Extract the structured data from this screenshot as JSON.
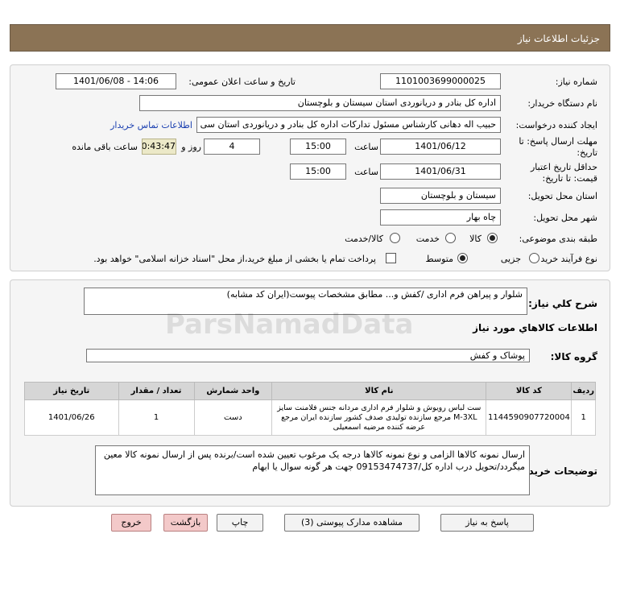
{
  "header": {
    "title": "جزئیات اطلاعات نیاز"
  },
  "form": {
    "need_number_label": "شماره نیاز:",
    "need_number": "1101003699000025",
    "announce_label": "تاریخ و ساعت اعلان عمومی:",
    "announce_value": "1401/06/08 - 14:06",
    "buyer_org_label": "نام دستگاه خریدار:",
    "buyer_org": "اداره کل بنادر و دریانوردی استان سیستان و بلوچستان",
    "creator_label": "ایجاد کننده درخواست:",
    "creator": "حبیب اله دهانی کارشناس مسئول تدارکات اداره کل بنادر و دریانوردی استان سی",
    "contact_link": "اطلاعات تماس خریدار",
    "reply_deadline_label": "مهلت ارسال پاسخ: تا",
    "reply_deadline_label2": "تاریخ:",
    "reply_date": "1401/06/12",
    "time_label": "ساعت",
    "reply_time": "15:00",
    "days_value": "4",
    "days_label": "روز و",
    "remaining_value": "00:43:47",
    "remaining_label": "ساعت باقی مانده",
    "validity_label": "حداقل تاریخ اعتبار",
    "validity_label2": "قیمت: تا تاریخ:",
    "validity_date": "1401/06/31",
    "validity_time_label": "ساعت",
    "validity_time": "15:00",
    "province_label": "استان محل تحویل:",
    "province": "سیستان و بلوچستان",
    "city_label": "شهر محل تحویل:",
    "city": "چاه بهار",
    "category_label": "طبقه بندی موضوعی:",
    "category_options": [
      "کالا",
      "خدمت",
      "کالا/خدمت"
    ],
    "process_label": "نوع فرآیند خرید :",
    "process_options": [
      "جزیی",
      "متوسط"
    ],
    "payment_note": "پرداخت تمام یا بخشی از مبلغ خرید،از محل \"اسناد خزانه اسلامی\" خواهد بود."
  },
  "summary": {
    "label": "شرح کلي نياز:",
    "value": "شلوار و پیراهن فرم اداری /کفش و... مطابق مشخصات پیوست(ایران کد مشابه)"
  },
  "goods_section_title": "اطلاعات کالاهاي مورد نياز",
  "goods_group": {
    "label": "گروه کالا:",
    "value": "پوشاک و کفش"
  },
  "table": {
    "headers": [
      "ردیف",
      "کد کالا",
      "نام کالا",
      "واحد شمارش",
      "تعداد / مقدار",
      "تاریخ نیاز"
    ],
    "rows": [
      {
        "row": "1",
        "code": "1144590907720004",
        "name": "ست لباس رویوش و شلوار فرم اداری مردانه جنس فلامنت سایز M-3XL مرجع سازنده تولیدی صدف کشور سازنده ایران مرجع عرضه کننده مرضیه اسمعیلی",
        "unit": "دست",
        "qty": "1",
        "date": "1401/06/26"
      }
    ]
  },
  "buyer_notes": {
    "label": "توضیحات خریدار:",
    "value": "ارسال نمونه کالاها الزامی و نوع نمونه کالاها درجه یک مرغوب تعیین شده است/برنده پس از ارسال نمونه کالا معین میگردد/تحویل درب اداره کل/09153474737 جهت هر گونه سوال یا ابهام"
  },
  "buttons": {
    "reply": "پاسخ به نیاز",
    "docs": "مشاهده مدارک پیوستی (3)",
    "print": "چاپ",
    "back": "بازگشت",
    "exit": "خروج"
  },
  "colors": {
    "header_bg": "#8b7355",
    "red_button": "#f3c9c9",
    "table_header": "#d6d6d6"
  }
}
